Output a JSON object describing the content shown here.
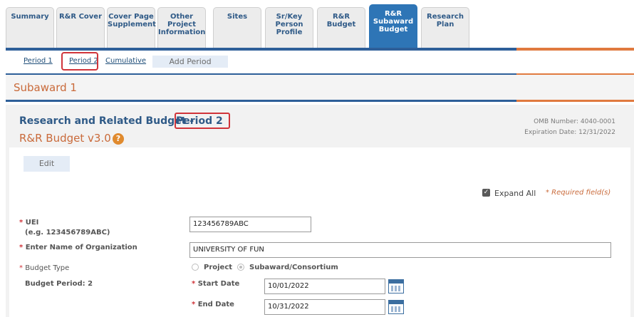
{
  "tabs": [
    {
      "label": "Summary"
    },
    {
      "label": "R&R Cover"
    },
    {
      "label": "Cover Page Supplement"
    },
    {
      "label": "Other Project Information"
    },
    {
      "label": "Sites"
    },
    {
      "label": "Sr/Key Person Profile"
    },
    {
      "label": "R&R Budget"
    },
    {
      "label": "R&R Subaward Budget"
    },
    {
      "label": "Research Plan"
    }
  ],
  "periods": {
    "period1": "Period 1",
    "period2": "Period 2",
    "cumulative": "Cumulative",
    "add_period": "Add Period"
  },
  "subaward_title": "Subaward 1",
  "form": {
    "title": "Research and Related Budget -",
    "period": "Period 2",
    "version": "R&R Budget v3.0",
    "help": "?",
    "omb_number": "OMB Number: 4040-0001",
    "expiration": "Expiration Date: 12/31/2022",
    "edit": "Edit",
    "expand_all": "Expand All",
    "required_note": "* Required field(s)",
    "uei_label": "UEI",
    "uei_example": "(e.g. 123456789ABC)",
    "uei_value": "123456789ABC",
    "org_label": "Enter Name of Organization",
    "org_value": "UNIVERSITY OF FUN",
    "budget_type_label": "Budget Type",
    "opt_project": "Project",
    "opt_subaward": "Subaward/Consortium",
    "budget_period_label": "Budget Period: 2",
    "start_label": "Start Date",
    "start_value": "10/01/2022",
    "end_label": "End Date",
    "end_value": "10/31/2022"
  },
  "colors": {
    "accent_blue": "#2e5f99",
    "accent_orange": "#e07a3f",
    "highlight_red": "#d0343a"
  }
}
